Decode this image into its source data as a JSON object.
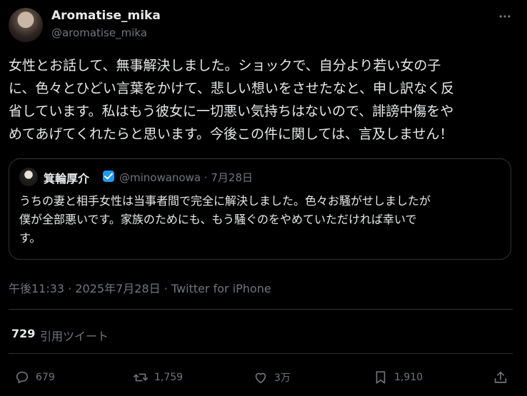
{
  "author": {
    "display_name": "Aromatise_mika",
    "handle": "@aromatise_mika"
  },
  "tweet": {
    "text": "女性とお話して、無事解決しました。ショックで、自分より若い女の子\nに、色々とひどい言葉をかけて、悲しい想いをさせたなと、申し訳なく反\n省しています。私はもう彼女に一切悪い気持ちはないので、誹謗中傷をや\nめてあげてくれたらと思います。今後この件に関しては、言及しません！",
    "meta": "午後11:33 · 2025年7月28日 · Twitter for iPhone"
  },
  "quoted": {
    "display_name": "箕輪厚介",
    "handle_date": "@minowanowa · 7月28日",
    "text": "うちの妻と相手女性は当事者間で完全に解決しました。色々お騒がせしましたが\n僕が全部悪いです。家族のためにも、もう騒ぐのをやめていただければ幸いで\nす。"
  },
  "quote_tweets": {
    "count": "729",
    "label": "引用ツイート"
  },
  "actions": {
    "replies": "679",
    "retweets": "1,759",
    "likes": "3万",
    "bookmarks": "1,910"
  },
  "icons": {
    "more": "more-icon",
    "verified": "verified-badge-icon",
    "reply": "reply-icon",
    "retweet": "retweet-icon",
    "like": "heart-icon",
    "bookmark": "bookmark-icon",
    "share": "share-icon"
  },
  "colors": {
    "background": "#000000",
    "text": "#e7e9ea",
    "secondary": "#71767b",
    "border": "#2f3336",
    "verified": "#1d9bf0"
  }
}
